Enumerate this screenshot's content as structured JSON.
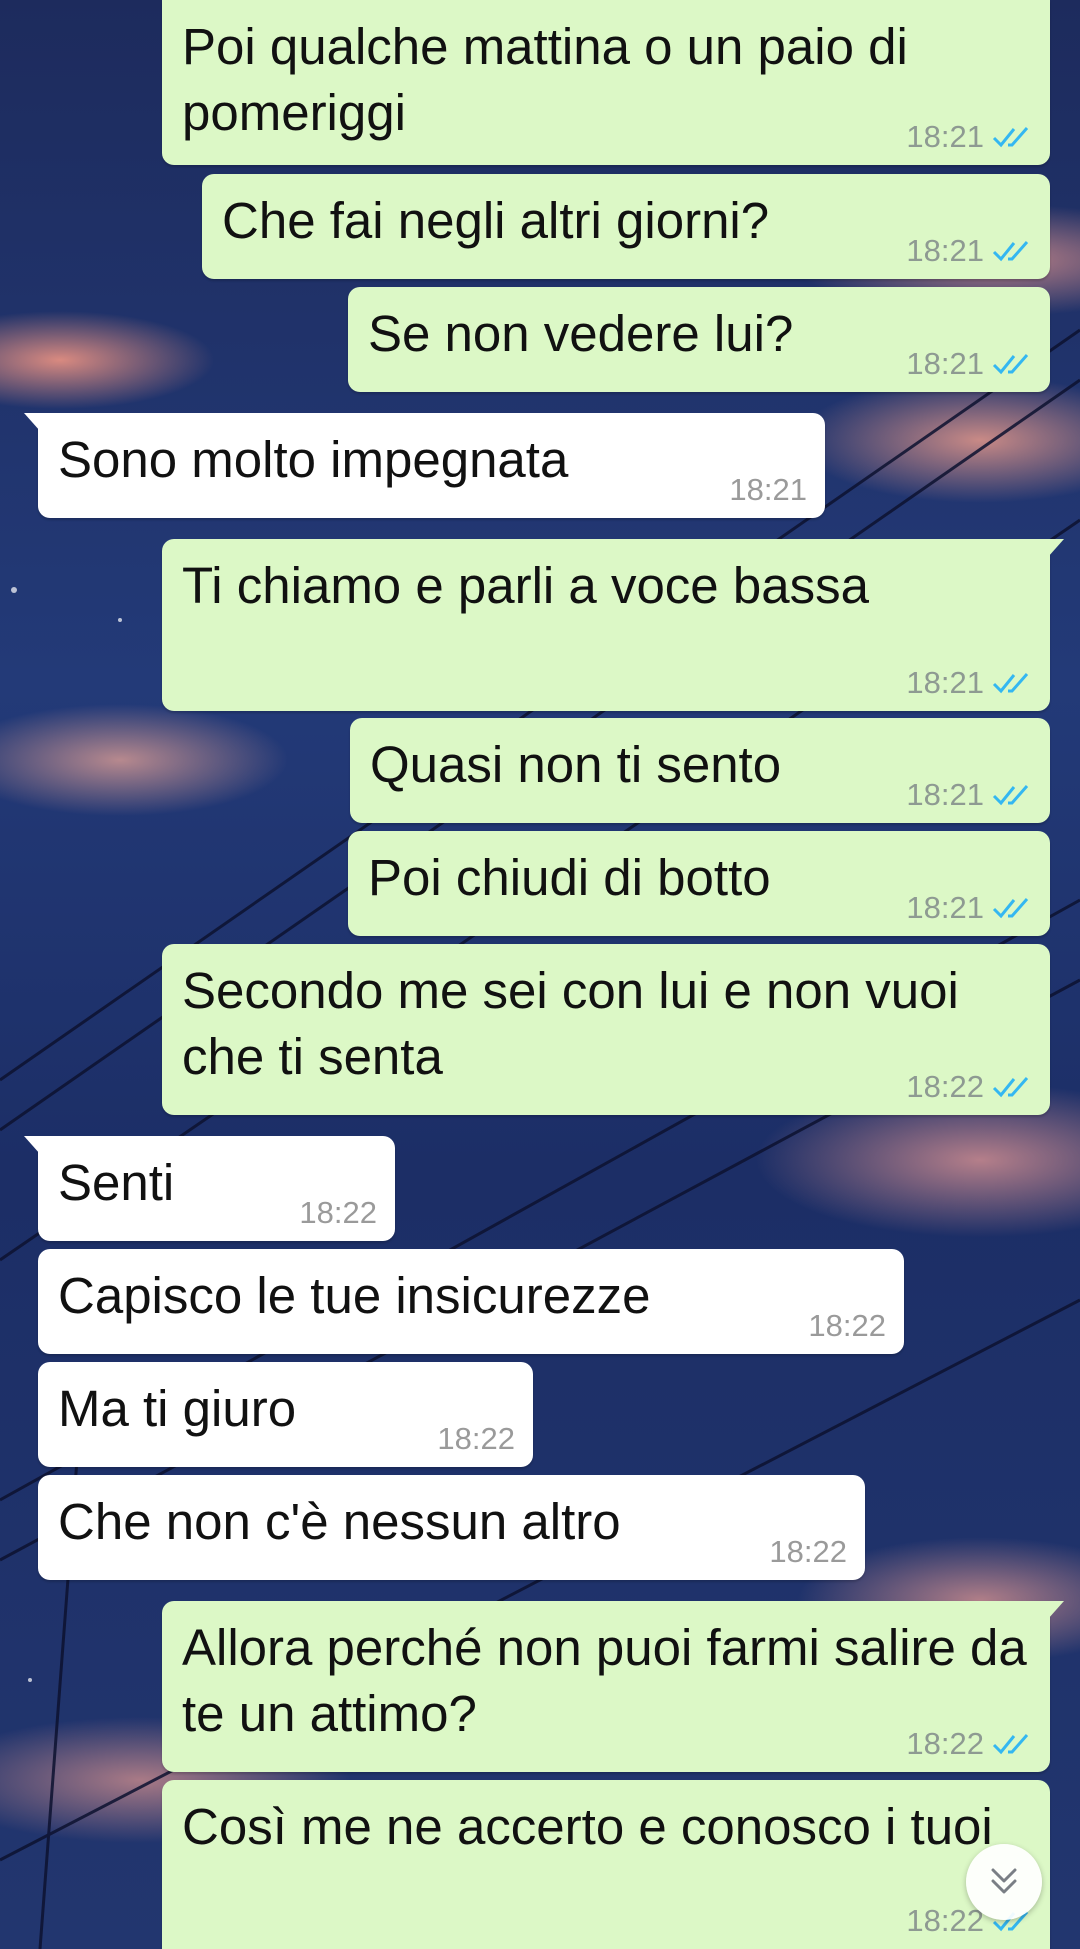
{
  "colors": {
    "outgoing_bubble": "#dcf8c6",
    "incoming_bubble": "#ffffff",
    "read_ticks": "#34b7f1",
    "timestamp": "#8e9a92"
  },
  "messages": [
    {
      "direction": "out",
      "text": "Poi qualche mattina o un paio di pomeriggi",
      "time": "18:21",
      "status": "read"
    },
    {
      "direction": "out",
      "text": "Che fai negli altri giorni?",
      "time": "18:21",
      "status": "read"
    },
    {
      "direction": "out",
      "text": "Se non vedere lui?",
      "time": "18:21",
      "status": "read"
    },
    {
      "direction": "in",
      "text": "Sono molto impegnata",
      "time": "18:21"
    },
    {
      "direction": "out",
      "text": "Ti chiamo e parli a voce bassa",
      "time": "18:21",
      "status": "read"
    },
    {
      "direction": "out",
      "text": "Quasi non ti sento",
      "time": "18:21",
      "status": "read"
    },
    {
      "direction": "out",
      "text": "Poi chiudi di botto",
      "time": "18:21",
      "status": "read"
    },
    {
      "direction": "out",
      "text": "Secondo me sei con lui e non vuoi che ti senta",
      "time": "18:22",
      "status": "read"
    },
    {
      "direction": "in",
      "text": "Senti",
      "time": "18:22"
    },
    {
      "direction": "in",
      "text": "Capisco le tue insicurezze",
      "time": "18:22"
    },
    {
      "direction": "in",
      "text": "Ma ti giuro",
      "time": "18:22"
    },
    {
      "direction": "in",
      "text": "Che non c'è nessun altro",
      "time": "18:22"
    },
    {
      "direction": "out",
      "text": "Allora perché non puoi farmi salire da te un attimo?",
      "time": "18:22",
      "status": "read"
    },
    {
      "direction": "out",
      "text": "Così me ne accerto e conosco i tuoi",
      "time": "18:22",
      "status": "read"
    }
  ],
  "icons": {
    "read_receipt": "double-check-icon",
    "scroll_down": "double-chevron-down-icon"
  }
}
